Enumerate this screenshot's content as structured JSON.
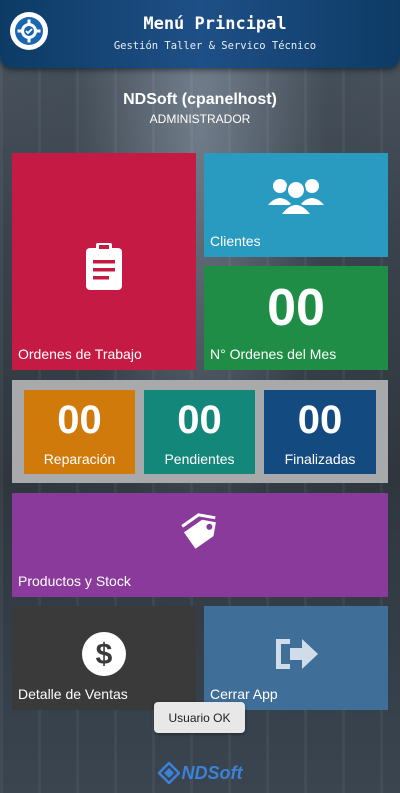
{
  "header": {
    "title": "Menú Principal",
    "subtitle": "Gestión Taller & Servico Técnico",
    "logo_icon": "gear-check-icon"
  },
  "user": {
    "name": "NDSoft (cpanelhost)",
    "role": "ADMINISTRADOR"
  },
  "tiles": {
    "ordenes": {
      "label": "Ordenes de Trabajo",
      "icon": "clipboard-icon",
      "color": "#c51a44"
    },
    "clientes": {
      "label": "Clientes",
      "icon": "users-icon",
      "color": "#2a9bc0"
    },
    "ordenes_mes": {
      "label": "N° Ordenes del Mes",
      "value": "00",
      "color": "#1f8d46"
    },
    "reparacion": {
      "label": "Reparación",
      "value": "00",
      "color": "#d17a0c"
    },
    "pendientes": {
      "label": "Pendientes",
      "value": "00",
      "color": "#12877a"
    },
    "finalizadas": {
      "label": "Finalizadas",
      "value": "00",
      "color": "#134a80"
    },
    "productos": {
      "label": "Productos y Stock",
      "icon": "tag-icon",
      "color": "#8a3a9a"
    },
    "ventas": {
      "label": "Detalle de Ventas",
      "icon": "dollar-icon",
      "color": "#3a3a3a"
    },
    "cerrar": {
      "label": "Cerrar App",
      "icon": "sign-out-icon",
      "color": "#3f6f98"
    }
  },
  "toast": {
    "text": "Usuario OK"
  },
  "footer": {
    "brand": "NDSoft"
  }
}
